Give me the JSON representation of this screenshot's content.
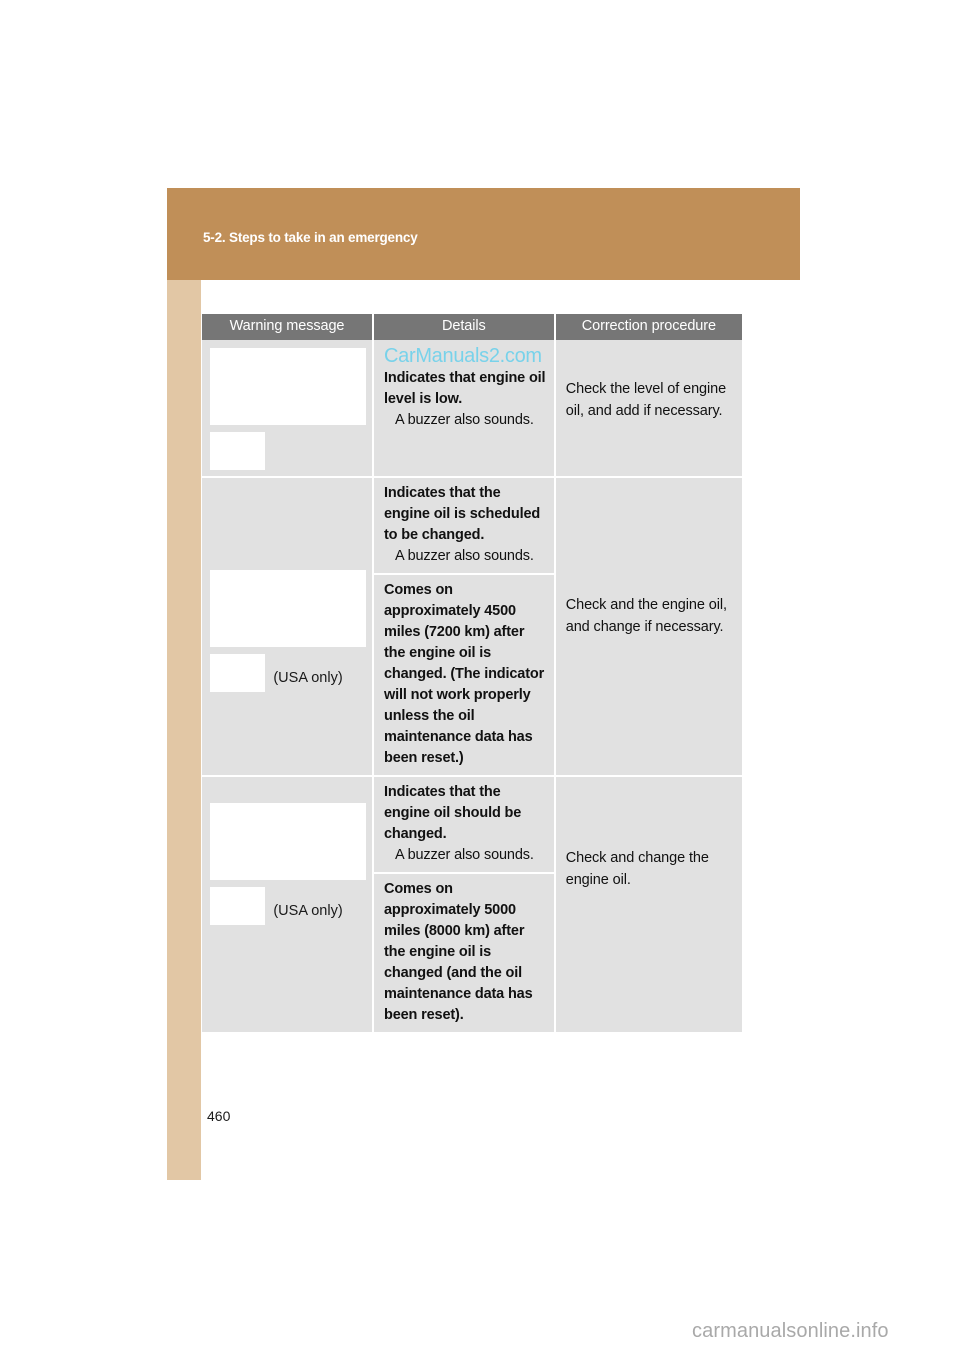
{
  "page": {
    "number": "460",
    "footer_watermark": "carmanualsonline.info",
    "inline_watermark": "CarManuals2.com",
    "colors": {
      "header_bar": "#c08f58",
      "side_strip": "#e2c7a5",
      "table_header": "#767676",
      "cell_bg": "#e1e1e1",
      "watermark_blue": "#78d2ea",
      "footer_grey": "#a9a9a9"
    }
  },
  "header": {
    "title": "5-2. Steps to take in an emergency"
  },
  "table": {
    "columns": [
      {
        "label": "Warning message"
      },
      {
        "label": "Details"
      },
      {
        "label": "Correction procedure"
      }
    ],
    "rows": [
      {
        "warning_message": {
          "images": [
            "warning-indicator-large",
            "warning-indicator-small"
          ],
          "note": ""
        },
        "details": [
          {
            "text": "Indicates that engine oil level is low.",
            "buzzer": "A buzzer also sounds."
          }
        ],
        "correction": "Check the level of engine oil, and add if necessary."
      },
      {
        "warning_message": {
          "images": [
            "warning-indicator-large",
            "warning-indicator-small"
          ],
          "note": "(USA only)"
        },
        "details": [
          {
            "text": "Indicates that the engine oil is scheduled to be changed.",
            "buzzer": "A buzzer also sounds."
          },
          {
            "text": "Comes on approximately 4500 miles (7200 km) after the engine oil is changed. (The indicator will not work properly unless the oil maintenance data has been reset.)",
            "buzzer": ""
          }
        ],
        "correction": "Check and the engine oil, and change if necessary."
      },
      {
        "warning_message": {
          "images": [
            "warning-indicator-large",
            "warning-indicator-small"
          ],
          "note": "(USA only)"
        },
        "details": [
          {
            "text": "Indicates that the engine oil should be changed.",
            "buzzer": "A buzzer also sounds."
          },
          {
            "text": "Comes on approximately 5000 miles (8000 km) after the engine oil is changed (and the oil maintenance data has been reset).",
            "buzzer": ""
          }
        ],
        "correction": "Check and change the engine oil."
      }
    ]
  }
}
